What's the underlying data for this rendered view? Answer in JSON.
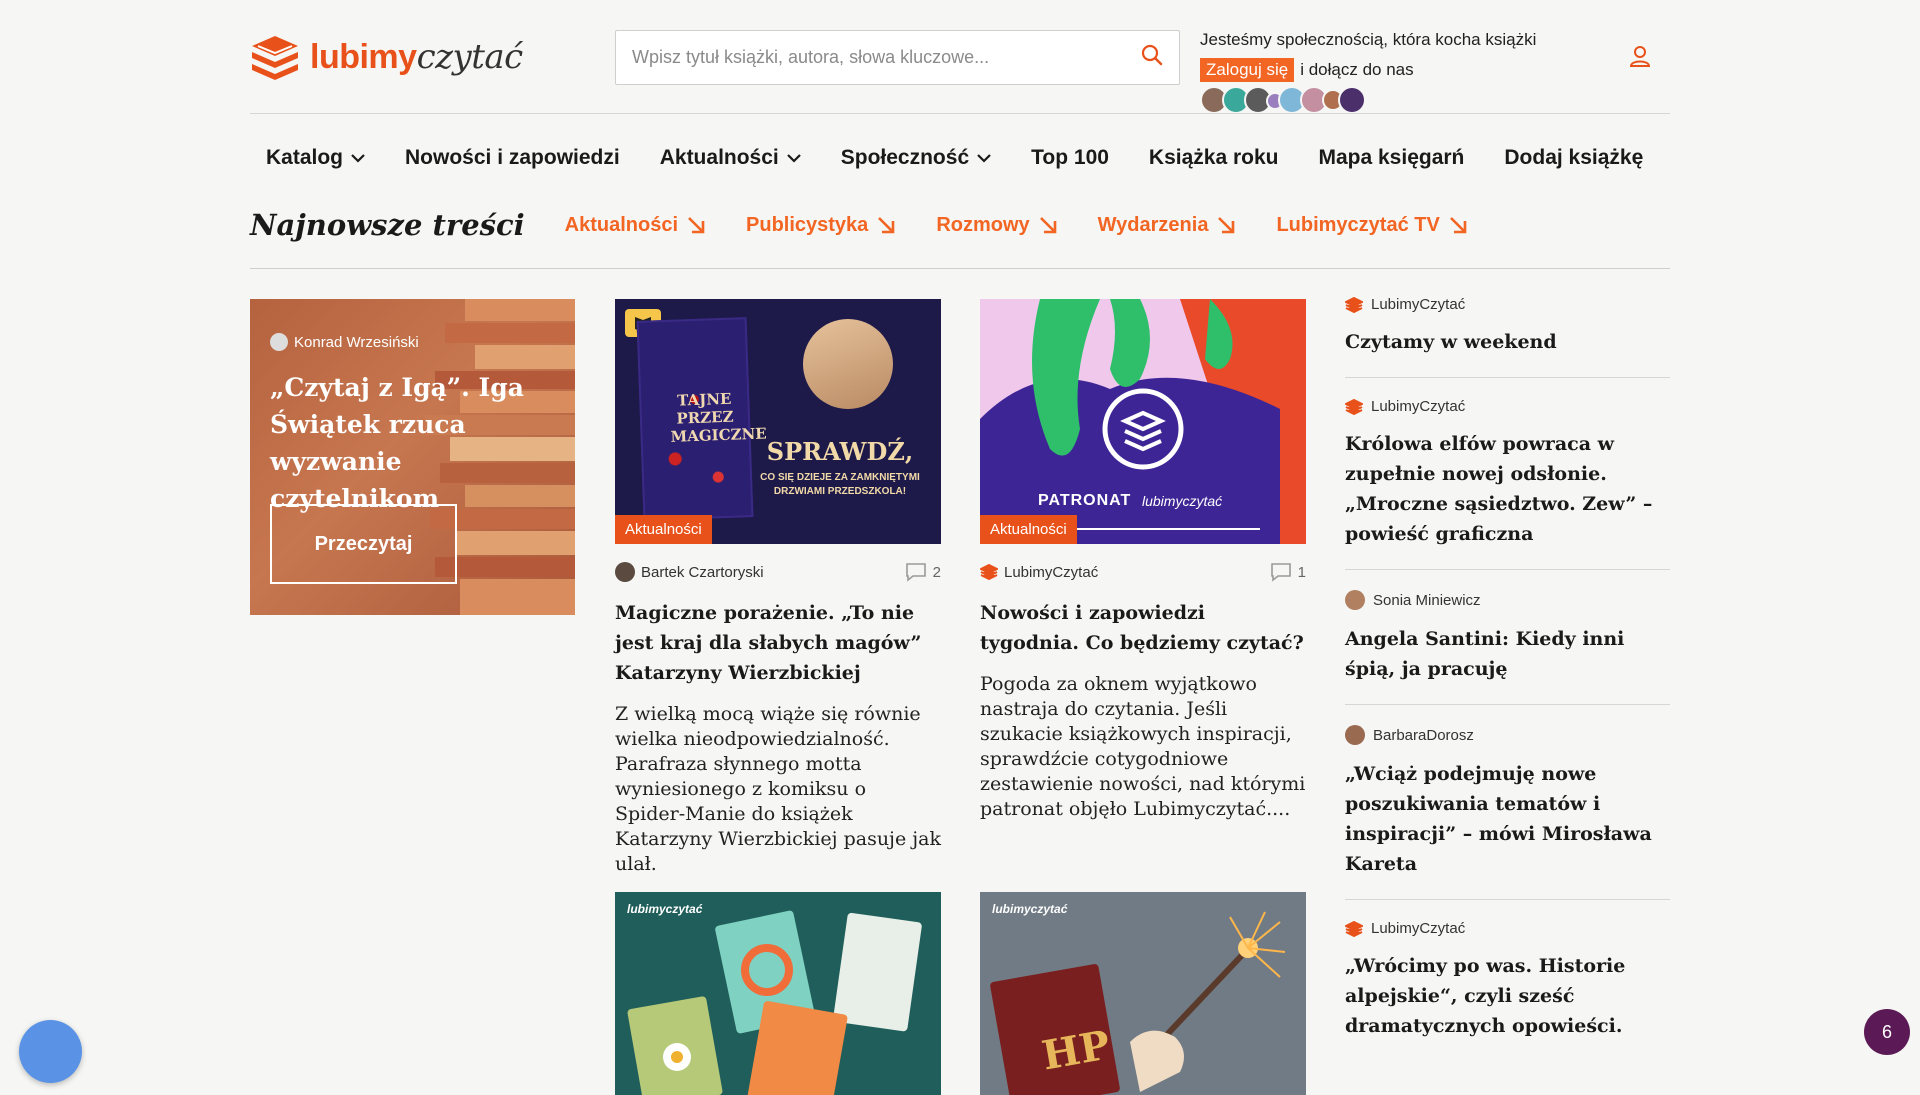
{
  "header": {
    "logo_word1": "lubimy",
    "logo_word2": "czytać",
    "search_placeholder": "Wpisz tytuł książki, autora, słowa kluczowe...",
    "community_text": "Jesteśmy społecznością, która kocha książki",
    "login_label": "Zaloguj się",
    "join_text": "i dołącz do nas"
  },
  "nav": {
    "items": [
      "Katalog",
      "Nowości i zapowiedzi",
      "Aktualności",
      "Społeczność",
      "Top 100",
      "Książka roku",
      "Mapa księgarń",
      "Dodaj książkę"
    ]
  },
  "subnav": {
    "title": "Najnowsze treści",
    "links": [
      "Aktualności",
      "Publicystyka",
      "Rozmowy",
      "Wydarzenia",
      "Lubimyczytać TV"
    ]
  },
  "featured": {
    "author": "Konrad Wrzesiński",
    "title": "„Czytaj z Igą”. Iga Świątek rzuca wyzwanie czytelnikom",
    "button": "Przeczytaj"
  },
  "cards": [
    {
      "tag": "Aktualności",
      "author": "Bartek Czartoryski",
      "comments": "2",
      "title": "Magiczne porażenie. „To nie jest kraj dla słabych magów” Katarzyny Wierzbickiej",
      "excerpt": "Z wielką mocą wiąże się równie wielka nieodpowiedzialność. Parafraza słynnego motta wyniesionego z komiksu o Spider-Manie do książek Katarzyny Wierzbickiej pasuje jak ulał.",
      "img_text1": "SPRAWDŹ,",
      "img_text2": "CO SIĘ DZIEJE ZA ZAMKNIĘTYMI DRZWIAMI PRZEDSZKOLA!",
      "img_book": "TAJNE PRZEZ MAGICZNE"
    },
    {
      "tag": "Aktualności",
      "author": "LubimyCzytać",
      "comments": "1",
      "title": "Nowości i zapowiedzi tygodnia. Co będziemy czytać?",
      "excerpt": "Pogoda za oknem wyjątkowo nastraja do czytania. Jeśli szukacie książkowych inspiracji, sprawdźcie cotygodniowe zestawienie nowości, nad którymi patronat objęło Lubimyczytać....",
      "img_text1": "PATRONAT",
      "img_brand": "lubimyczytać"
    }
  ],
  "bottom_cards": [
    {
      "brand": "lubimyczytać"
    },
    {
      "brand": "lubimyczytać",
      "book_letters": "HP"
    }
  ],
  "side": [
    {
      "source": "LubimyCzytać",
      "title": "Czytamy w weekend"
    },
    {
      "source": "LubimyCzytać",
      "title": "Królowa elfów powraca w zupełnie nowej odsłonie. „Mroczne sąsiedztwo. Zew” – powieść graficzna"
    },
    {
      "source": "Sonia Miniewicz",
      "title": "Angela Santini: Kiedy inni śpią, ja pracuję"
    },
    {
      "source": "BarbaraDorosz",
      "title": "„Wciąż podejmuję nowe poszukiwania tematów i inspiracji” – mówi Mirosława Kareta"
    },
    {
      "source": "LubimyCzytać",
      "title": "„Wrócimy po was. Historie alpejskie“, czyli sześć dramatycznych opowieści."
    }
  ],
  "fab_count": "6",
  "colors": {
    "accent": "#f26522",
    "accent_dark": "#e8521a",
    "fab_purple": "#5b1a56",
    "fab_blue": "#5a93e6"
  }
}
